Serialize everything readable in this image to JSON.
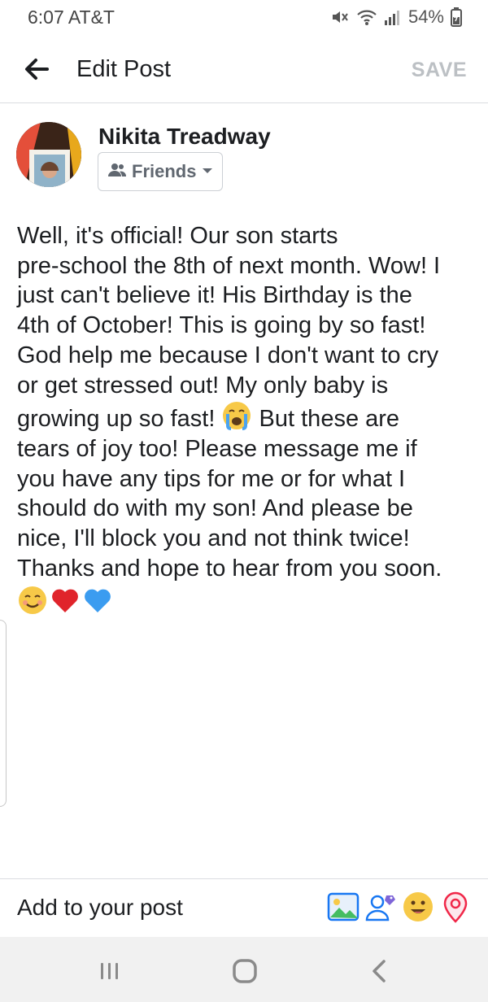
{
  "status_bar": {
    "time_carrier": "6:07 AT&T",
    "battery": "54%"
  },
  "header": {
    "title": "Edit Post",
    "save_label": "SAVE"
  },
  "author": {
    "name": "Nikita Treadway",
    "audience": "Friends"
  },
  "post": {
    "lines": [
      "Well, it's official! Our son starts",
      "pre-school the 8th of next month. Wow! I",
      "just can't believe it! His Birthday is the",
      "4th of October! This is going by so fast!",
      "God help me because I don't want to cry",
      "or get stressed out! My only baby is",
      "growing up so fast! ",
      " But these are",
      "tears of joy too! Please message me if",
      "you have any tips for me or for what I",
      "should do with my son! And please be",
      "nice, I'll block you and not think twice!",
      "Thanks and hope to hear from you soon."
    ]
  },
  "add_to_post": {
    "label": "Add to your post"
  },
  "icons": {
    "back": "arrow-left-icon",
    "audience": "friends-icon",
    "photo": "photo-icon",
    "tag": "tag-people-icon",
    "feeling": "feeling-icon",
    "location": "location-pin-icon"
  },
  "colors": {
    "accent": "#1877f2",
    "save_disabled": "#bcc0c4"
  }
}
